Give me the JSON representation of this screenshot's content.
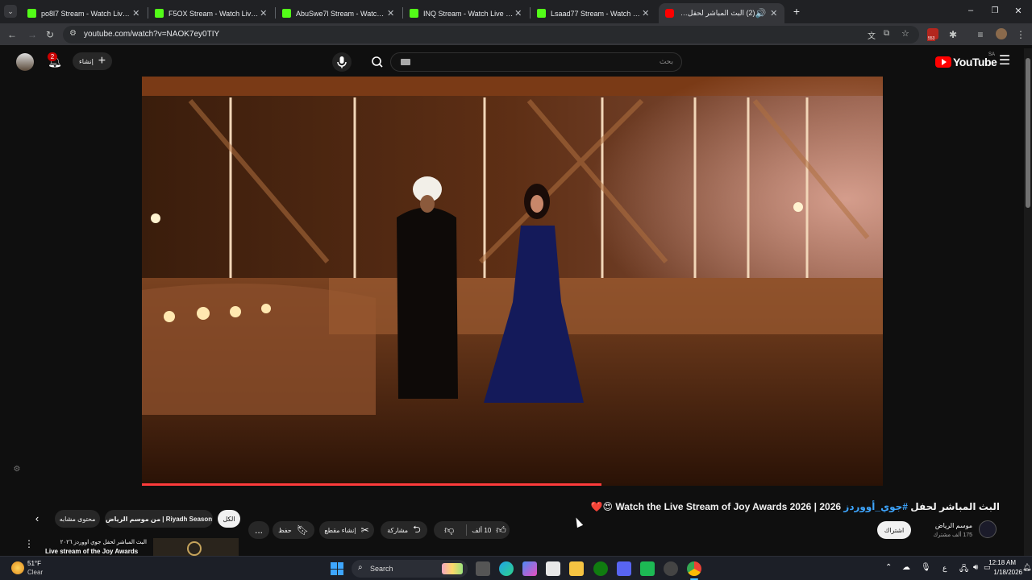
{
  "browser": {
    "tabs": [
      {
        "title": "po8l7 Stream - Watch Live on K",
        "active": false
      },
      {
        "title": "F5OX Stream - Watch Live on K",
        "active": false
      },
      {
        "title": "AbuSwe7l Stream - Watch Live",
        "active": false
      },
      {
        "title": "INQ Stream - Watch Live on Kic",
        "active": false
      },
      {
        "title": "Lsaad77 Stream - Watch Live or",
        "active": false
      },
      {
        "title": "(2) البث المباشر لحفل #جوي",
        "active": true
      }
    ],
    "url": "youtube.com/watch?v=NAOK7ey0TIY",
    "profile_badge": "553"
  },
  "youtube": {
    "logo_text": "YouTube",
    "region": "SA",
    "search_placeholder": "بحث",
    "create_label": "إنشاء",
    "notifications_count": "2",
    "video": {
      "title_prefix": "البث المباشر لحفل ",
      "title_hashtag": "#جوي_أووردز",
      "title_suffix": " 2026 | Watch the Live Stream of Joy Awards 2026 😍❤️"
    },
    "channel": {
      "name": "موسم الرياض",
      "subscribers": "175 ألف مشترك",
      "subscribe_label": "اشتراك"
    },
    "actions": {
      "likes": "10 ألف",
      "share_label": "مشاركة",
      "clip_label": "إنشاء مقطع",
      "save_label": "حفظ",
      "more_label": "..."
    },
    "chips": [
      {
        "label": "الكل",
        "selected": true
      },
      {
        "label": "من موسم الرياض | Riyadh Season",
        "selected": false
      },
      {
        "label": "محتوى مشابه",
        "selected": false
      }
    ],
    "related": {
      "title_line1": "البث المباشر لحفل جوي اووردز ٢٠٢٦",
      "title_line2": "Live stream of the  Joy Awards"
    }
  },
  "taskbar": {
    "weather_temp": "51°F",
    "weather_desc": "Clear",
    "search_label": "Search",
    "time": "12:18 AM",
    "date": "1/18/2026",
    "lang": "ع"
  }
}
